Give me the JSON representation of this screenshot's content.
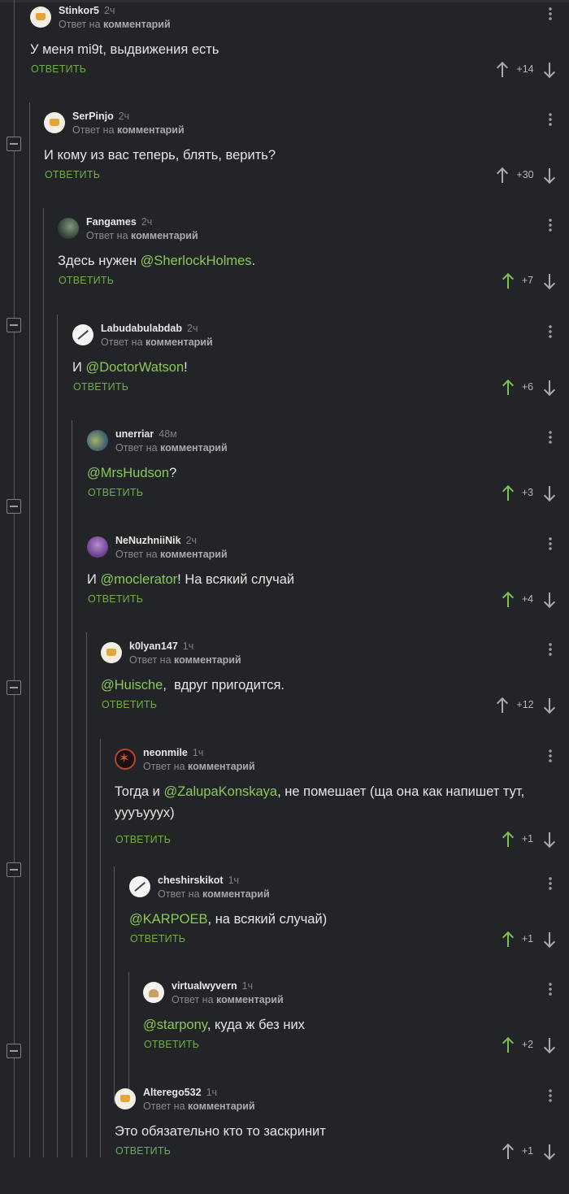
{
  "ui": {
    "reply_prefix": "Ответ на",
    "reply_target": "комментарий",
    "reply_button": "ОТВЕТИТЬ"
  },
  "comments": [
    {
      "author": "Stinkor5",
      "time": "2ч",
      "avatar": "default-avatar-icon",
      "pre": "У меня mi9t, выдвижения есть",
      "mention": "",
      "post": "",
      "score": "+14",
      "upvoted": false
    },
    {
      "author": "SerPinjo",
      "time": "2ч",
      "avatar": "default-avatar-icon",
      "pre": "И кому из вас теперь, блять, верить?",
      "mention": "",
      "post": "",
      "score": "+30",
      "upvoted": false
    },
    {
      "author": "Fangames",
      "time": "2ч",
      "avatar": "user-avatar-icon",
      "pre": "Здесь нужен ",
      "mention": "@SherlockHolmes",
      "post": ".",
      "score": "+7",
      "upvoted": true
    },
    {
      "author": "Labudabulabdab",
      "time": "2ч",
      "avatar": "user-avatar-icon",
      "pre": "И ",
      "mention": "@DoctorWatson",
      "post": "!",
      "score": "+6",
      "upvoted": true
    },
    {
      "author": "unerriar",
      "time": "48м",
      "avatar": "user-avatar-icon",
      "pre": "",
      "mention": "@MrsHudson",
      "post": "?",
      "score": "+3",
      "upvoted": true
    },
    {
      "author": "NeNuzhniiNik",
      "time": "2ч",
      "avatar": "user-avatar-icon",
      "pre": "И ",
      "mention": "@moclerator",
      "post": "! На всякий случай",
      "score": "+4",
      "upvoted": true
    },
    {
      "author": "k0lyan147",
      "time": "1ч",
      "avatar": "default-avatar-icon",
      "pre": "",
      "mention": "@Huische",
      "post": ",  вдруг пригодится.",
      "score": "+12",
      "upvoted": false
    },
    {
      "author": "neonmile",
      "time": "1ч",
      "avatar": "user-avatar-icon",
      "pre": "Тогда и ",
      "mention": "@ZalupaKonskaya",
      "post": ", не помешает (ща она как напишет тут,",
      "extra": "уууъууух)",
      "score": "+1",
      "upvoted": true
    },
    {
      "author": "cheshirskikot",
      "time": "1ч",
      "avatar": "user-avatar-icon",
      "pre": "",
      "mention": "@KARPOEB",
      "post": ", на всякий случай)",
      "score": "+1",
      "upvoted": true
    },
    {
      "author": "virtualwyvern",
      "time": "1ч",
      "avatar": "user-avatar-icon",
      "pre": "",
      "mention": "@starpony",
      "post": ", куда ж без них",
      "score": "+2",
      "upvoted": true
    },
    {
      "author": "Alterego532",
      "time": "1ч",
      "avatar": "default-avatar-icon",
      "pre": "Это обязательно кто то заскринит",
      "mention": "",
      "post": "",
      "score": "+1",
      "upvoted": false
    }
  ]
}
